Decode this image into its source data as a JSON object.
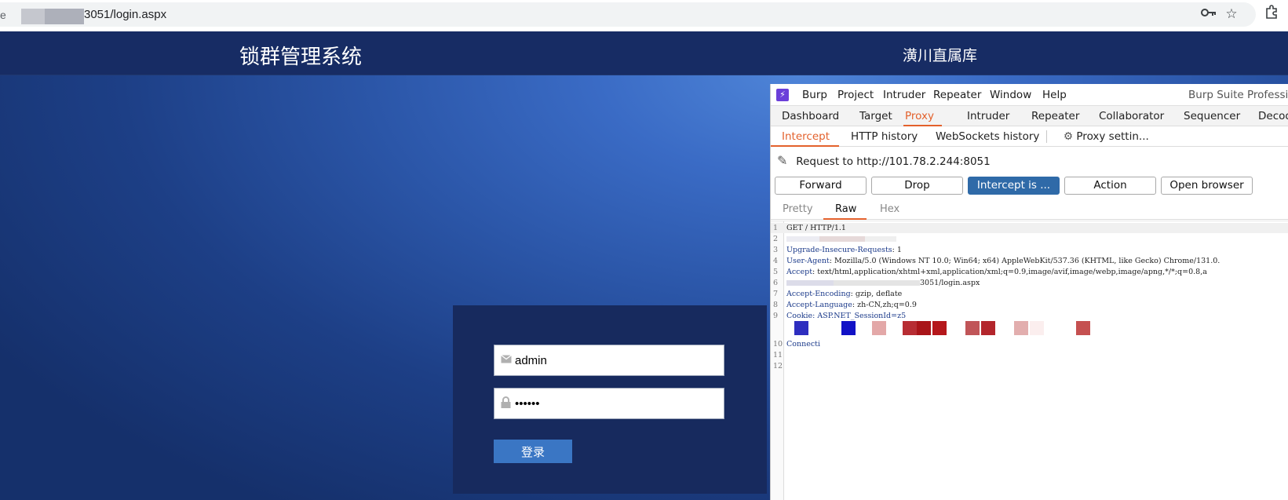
{
  "browser": {
    "edge_text": "e",
    "url_suffix": "3051/login.aspx",
    "icons": [
      "key-icon",
      "star-icon",
      "extensions-icon"
    ]
  },
  "page": {
    "system_title": "锁群管理系统",
    "unit_name": "潢川直属库",
    "login": {
      "username_value": "admin",
      "password_value": "••••••",
      "submit_label": "登录",
      "username_icon": "mail-icon",
      "password_icon": "lock-icon"
    }
  },
  "burp": {
    "menu": [
      "Burp",
      "Project",
      "Intruder",
      "Repeater",
      "Window",
      "Help"
    ],
    "title": "Burp Suite Professio",
    "main_tabs": [
      "Dashboard",
      "Target",
      "Proxy",
      "Intruder",
      "Repeater",
      "Collaborator",
      "Sequencer",
      "Decod"
    ],
    "active_main_tab": "Proxy",
    "sub_tabs": [
      "Intercept",
      "HTTP history",
      "WebSockets history"
    ],
    "active_sub_tab": "Intercept",
    "proxy_settings_label": "Proxy settin...",
    "request_to": "Request to http://101.78.2.244:8051",
    "buttons": {
      "forward": "Forward",
      "drop": "Drop",
      "intercept": "Intercept is ...",
      "action": "Action",
      "open_browser": "Open browser"
    },
    "view_tabs": [
      "Pretty",
      "Raw",
      "Hex"
    ],
    "active_view_tab": "Raw",
    "request_lines": [
      {
        "n": "1",
        "key": "",
        "value": "GET / HTTP/1.1"
      },
      {
        "n": "2",
        "key": "",
        "value": ""
      },
      {
        "n": "3",
        "key": "Upgrade-Insecure-Requests",
        "value": ": 1"
      },
      {
        "n": "4",
        "key": "User-Agent",
        "value": ": Mozilla/5.0 (Windows NT 10.0; Win64; x64) AppleWebKit/537.36 (KHTML, like Gecko) Chrome/131.0."
      },
      {
        "n": "5",
        "key": "Accept",
        "value": ": text/html,application/xhtml+xml,application/xml;q=0.9,image/avif,image/webp,image/apng,*/*;q=0.8,a"
      },
      {
        "n": "6",
        "key": "",
        "value": "3051/login.aspx"
      },
      {
        "n": "7",
        "key": "Accept-Encoding",
        "value": ": gzip, deflate"
      },
      {
        "n": "8",
        "key": "Accept-Language",
        "value": ": zh-CN,zh;q=0.9"
      },
      {
        "n": "9",
        "key": "Cookie",
        "value": ": ASP.NET_SessionId=z5"
      },
      {
        "n": "10",
        "key": "Connecti",
        "value": ""
      },
      {
        "n": "11",
        "key": "",
        "value": ""
      },
      {
        "n": "12",
        "key": "",
        "value": ""
      }
    ],
    "redaction_colors": [
      "#2e2ebf",
      "#1212c6",
      "#e3a8a8",
      "#b72d33",
      "#a91519",
      "#b5171b",
      "#c05558",
      "#b3262c",
      "#e2aeae",
      "#fbeeee",
      "#c55050"
    ]
  }
}
